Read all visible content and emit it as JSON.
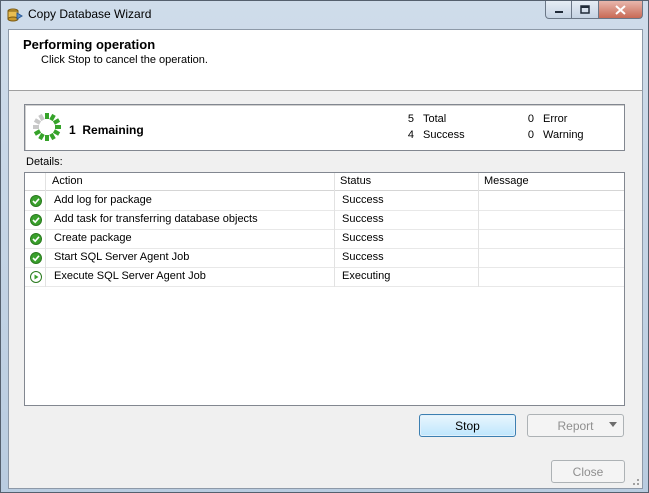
{
  "window": {
    "title": "Copy Database Wizard"
  },
  "header": {
    "title": "Performing operation",
    "subtitle": "Click Stop to cancel the operation."
  },
  "progress": {
    "remaining_count": "1",
    "remaining_label": "Remaining",
    "total_value": "5",
    "total_label": "Total",
    "success_value": "4",
    "success_label": "Success",
    "error_value": "0",
    "error_label": "Error",
    "warning_value": "0",
    "warning_label": "Warning"
  },
  "details": {
    "label": "Details:",
    "columns": [
      "Action",
      "Status",
      "Message"
    ],
    "rows": [
      {
        "action": "Add log for package",
        "status": "Success",
        "message": "",
        "icon": "success-check-icon"
      },
      {
        "action": "Add task for transferring database objects",
        "status": "Success",
        "message": "",
        "icon": "success-check-icon"
      },
      {
        "action": "Create package",
        "status": "Success",
        "message": "",
        "icon": "success-check-icon"
      },
      {
        "action": "Start SQL Server Agent Job",
        "status": "Success",
        "message": "",
        "icon": "success-check-icon"
      },
      {
        "action": "Execute SQL Server Agent Job",
        "status": "Executing",
        "message": "",
        "icon": "executing-play-icon"
      }
    ]
  },
  "buttons": {
    "stop": "Stop",
    "report": "Report",
    "close": "Close"
  },
  "colors": {
    "success": "#3aa02c",
    "accent": "#3c7fb1",
    "spinner_active": "#36a32a",
    "spinner_idle": "#c8c8c8"
  }
}
